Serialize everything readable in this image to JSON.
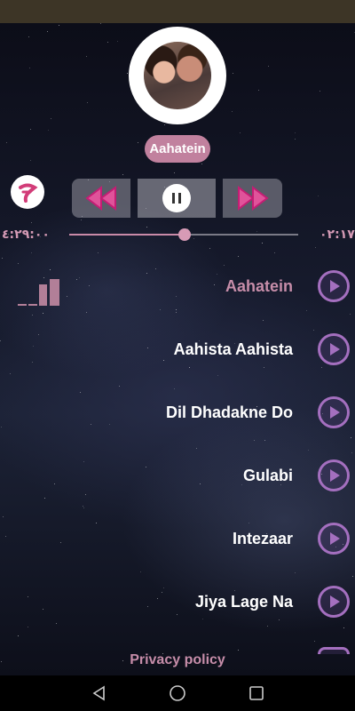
{
  "now_playing": {
    "title": "Aahatein"
  },
  "player": {
    "elapsed_time": "٠٢:١٧",
    "total_time": "٤:٢٩:٠٠",
    "progress_fraction": 0.5
  },
  "playlist": [
    {
      "title": "Aahatein",
      "active": true
    },
    {
      "title": "Aahista Aahista",
      "active": false
    },
    {
      "title": "Dil Dhadakne Do",
      "active": false
    },
    {
      "title": "Gulabi",
      "active": false
    },
    {
      "title": "Intezaar",
      "active": false
    },
    {
      "title": "Jiya Lage Na",
      "active": false
    }
  ],
  "footer": {
    "privacy_label": "Privacy policy"
  },
  "colors": {
    "accent_pink": "#c68da9",
    "accent_purple": "#a46fbf",
    "status_bar": "#3d3526"
  },
  "icons": {
    "logo": "app-logo-icon",
    "prev": "previous-icon",
    "pause": "pause-icon",
    "next": "next-icon",
    "equalizer": "equalizer-icon",
    "track_play": "play-icon",
    "nav_back": "back-icon",
    "nav_home": "home-icon",
    "nav_recents": "recents-icon"
  }
}
